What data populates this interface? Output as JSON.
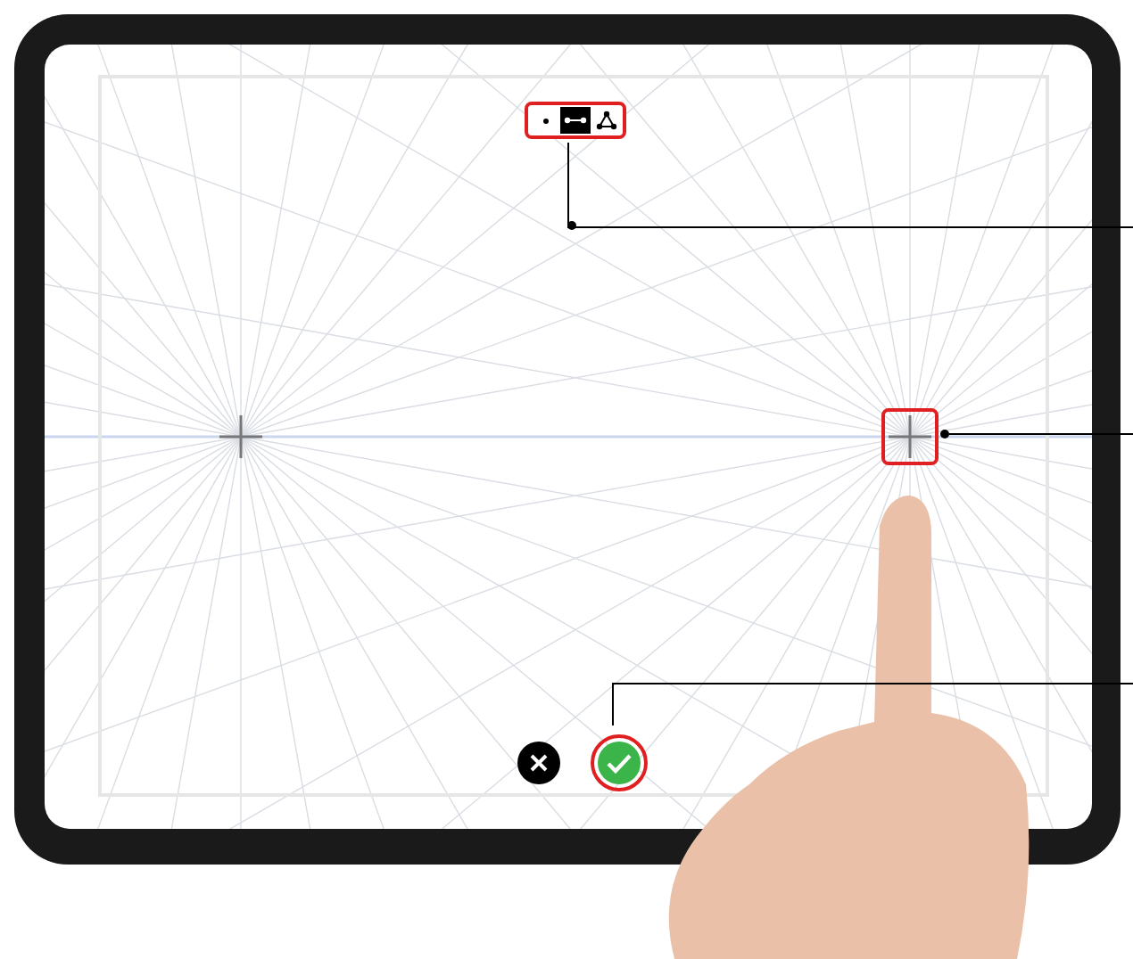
{
  "perspective_modes": [
    {
      "kind": "one-point",
      "selected": false
    },
    {
      "kind": "two-point",
      "selected": true
    },
    {
      "kind": "three-point",
      "selected": false
    }
  ],
  "vanishing_points": [
    {
      "highlighted": false
    },
    {
      "highlighted": true
    }
  ],
  "actions": [
    {
      "kind": "cancel",
      "highlighted": false
    },
    {
      "kind": "confirm",
      "highlighted": true
    }
  ]
}
